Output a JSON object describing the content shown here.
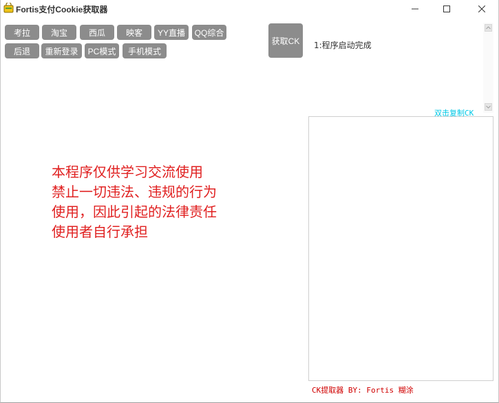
{
  "window": {
    "title": "Fortis支付Cookie获取器",
    "icon": "app-icon",
    "controls": {
      "minimize": "minimize-icon",
      "maximize": "maximize-icon",
      "close": "close-icon"
    }
  },
  "site_buttons": [
    {
      "label": "考拉"
    },
    {
      "label": "淘宝"
    },
    {
      "label": "西瓜"
    },
    {
      "label": "映客"
    },
    {
      "label": "YY直播"
    },
    {
      "label": "QQ综合"
    }
  ],
  "action_buttons": [
    {
      "label": "后退"
    },
    {
      "label": "重新登录"
    },
    {
      "label": "PC模式"
    },
    {
      "label": "手机模式"
    }
  ],
  "get_ck_button": {
    "label": "获取CK"
  },
  "log": {
    "lines": [
      "1:程序启动完成"
    ]
  },
  "copy_hint": "双击复制CK",
  "ck_output": {
    "value": ""
  },
  "disclaimer": "本程序仅供学习交流使用\n禁止一切违法、违规的行为\n使用，因此引起的法律责任\n使用者自行承担",
  "footer": "CK提取器 BY: Fortis  糊涂",
  "colors": {
    "button_bg": "#8c8c8c",
    "button_text": "#ffffff",
    "disclaimer": "#e02020",
    "copy_hint": "#00c8e6",
    "footer": "#d00000"
  }
}
